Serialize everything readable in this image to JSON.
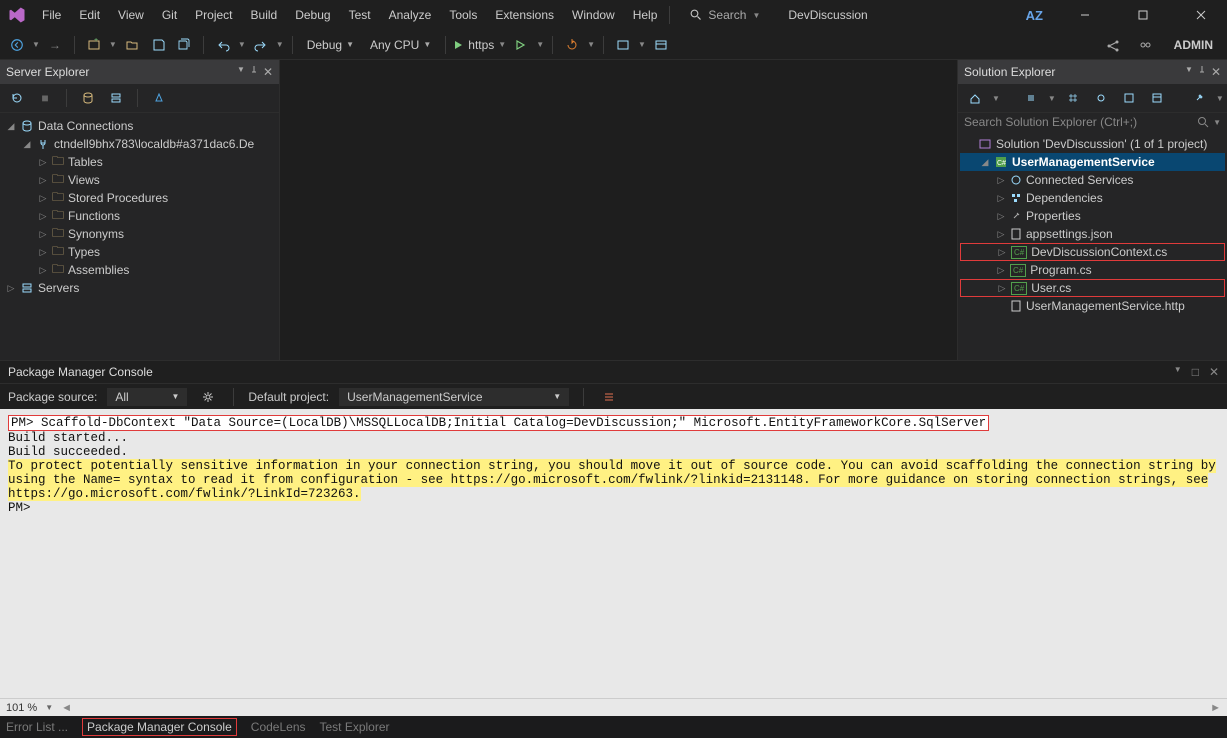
{
  "menu": [
    "File",
    "Edit",
    "View",
    "Git",
    "Project",
    "Build",
    "Debug",
    "Test",
    "Analyze",
    "Tools",
    "Extensions",
    "Window",
    "Help"
  ],
  "search_launch": "Search",
  "project_name": "DevDiscussion",
  "title_right": {
    "az": "AZ"
  },
  "toolbar": {
    "config": "Debug",
    "platform": "Any CPU",
    "launch": "https",
    "admin": "ADMIN"
  },
  "server_explorer": {
    "title": "Server Explorer",
    "root": "Data Connections",
    "conn": "ctndell9bhx783\\localdb#a371dac6.De",
    "folders": [
      "Tables",
      "Views",
      "Stored Procedures",
      "Functions",
      "Synonyms",
      "Types",
      "Assemblies"
    ],
    "servers": "Servers"
  },
  "solution_explorer": {
    "title": "Solution Explorer",
    "search_placeholder": "Search Solution Explorer (Ctrl+;)",
    "solution": "Solution 'DevDiscussion' (1 of 1 project)",
    "project": "UserManagementService",
    "items": [
      {
        "label": "Connected Services",
        "icon": "connected"
      },
      {
        "label": "Dependencies",
        "icon": "dep"
      },
      {
        "label": "Properties",
        "icon": "wrench"
      },
      {
        "label": "appsettings.json",
        "icon": "json"
      },
      {
        "label": "DevDiscussionContext.cs",
        "icon": "cs",
        "highlight": true
      },
      {
        "label": "Program.cs",
        "icon": "cs"
      },
      {
        "label": "User.cs",
        "icon": "cs",
        "highlight": true
      },
      {
        "label": "UserManagementService.http",
        "icon": "file"
      }
    ]
  },
  "pmc": {
    "title": "Package Manager Console",
    "pkg_src_label": "Package source:",
    "pkg_src_value": "All",
    "def_proj_label": "Default project:",
    "def_proj_value": "UserManagementService",
    "prompt": "PM>",
    "cmd": "Scaffold-DbContext \"Data Source=(LocalDB)\\MSSQLLocalDB;Initial Catalog=DevDiscussion;\" Microsoft.EntityFrameworkCore.SqlServer",
    "line1": "Build started...",
    "line2": "Build succeeded.",
    "warn": "To protect potentially sensitive information in your connection string, you should move it out of source code. You can avoid scaffolding the connection string by using the Name= syntax to read it from configuration - see https://go.microsoft.com/fwlink/?linkid=2131148. For more guidance on storing connection strings, see https://go.microsoft.com/fwlink/?LinkId=723263.",
    "prompt2": "PM>",
    "zoom": "101 %"
  },
  "footer": {
    "tabs": [
      "Error List ...",
      "Package Manager Console",
      "CodeLens",
      "Test Explorer"
    ]
  }
}
